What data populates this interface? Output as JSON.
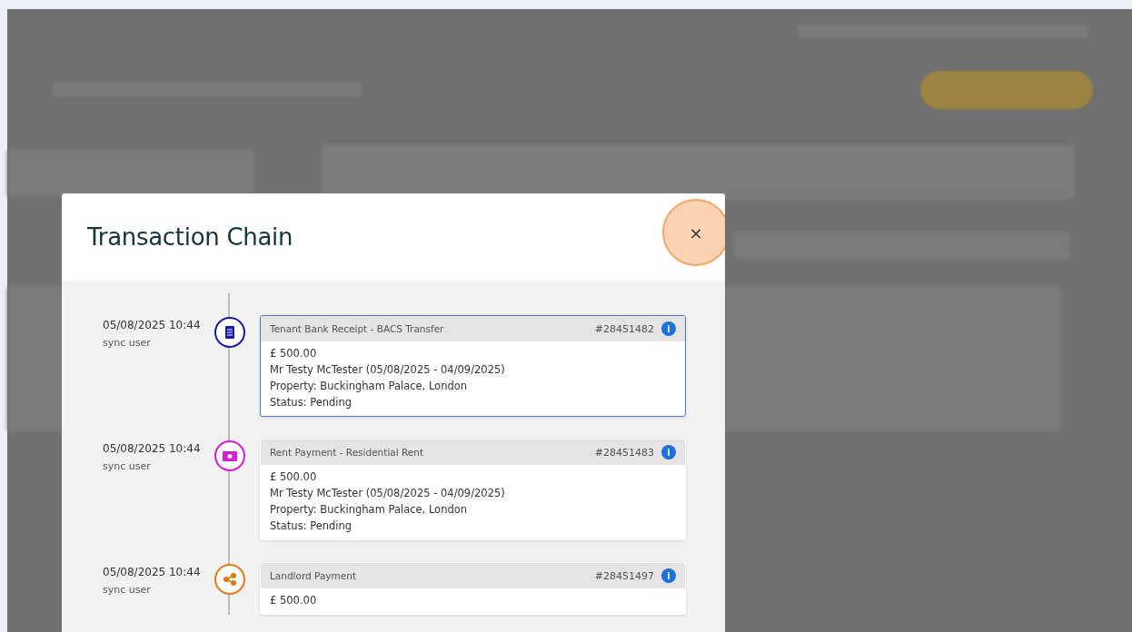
{
  "dialog": {
    "title": "Transaction Chain",
    "close_label": "×"
  },
  "entries": [
    {
      "time": "05/08/2025 10:44",
      "user": "sync user",
      "kind": "receipt",
      "color": "#1a1aa8",
      "selected": true,
      "title": "Tenant Bank Receipt - BACS Transfer",
      "ref": "#28451482",
      "info": "i",
      "lines": [
        "£ 500.00",
        "Mr Testy McTester (05/08/2025 - 04/09/2025)",
        "Property: Buckingham Palace, London",
        "Status: Pending"
      ]
    },
    {
      "time": "05/08/2025 10:44",
      "user": "sync user",
      "kind": "cash",
      "color": "#d91ad9",
      "selected": false,
      "title": "Rent Payment - Residential Rent",
      "ref": "#28451483",
      "info": "i",
      "lines": [
        "£ 500.00",
        "Mr Testy McTester (05/08/2025 - 04/09/2025)",
        "Property: Buckingham Palace, London",
        "Status: Pending"
      ]
    },
    {
      "time": "05/08/2025 10:44",
      "user": "sync user",
      "kind": "share",
      "color": "#e07b1a",
      "selected": false,
      "title": "Landlord Payment",
      "ref": "#28451497",
      "info": "i",
      "lines": [
        "£ 500.00"
      ]
    }
  ]
}
